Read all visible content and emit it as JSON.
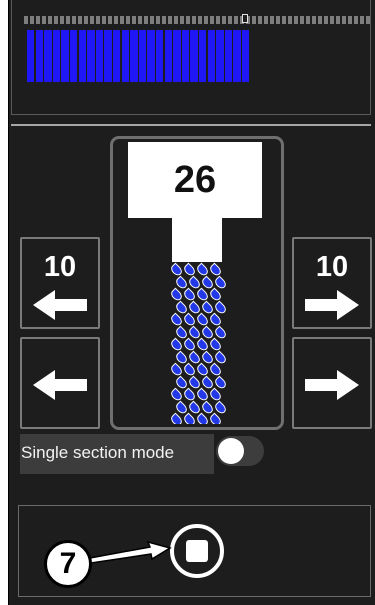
{
  "section_bar": {
    "tick_count": 58,
    "fill_segments": 26,
    "fill_color": "#1f17f5",
    "marker_position_fraction": 0.63
  },
  "application": {
    "rate_value": "26",
    "drop_color": "#2338e6"
  },
  "buttons": {
    "shift_left_10": {
      "label": "10",
      "icon": "arrow-left-icon"
    },
    "shift_right_10": {
      "label": "10",
      "icon": "arrow-right-icon"
    },
    "shift_left_1": {
      "icon": "arrow-left-icon"
    },
    "shift_right_1": {
      "icon": "arrow-right-icon"
    }
  },
  "single_section_mode": {
    "label": "Single section mode",
    "enabled": false
  },
  "stop": {
    "icon": "stop-icon"
  },
  "callout": {
    "number": "7"
  }
}
